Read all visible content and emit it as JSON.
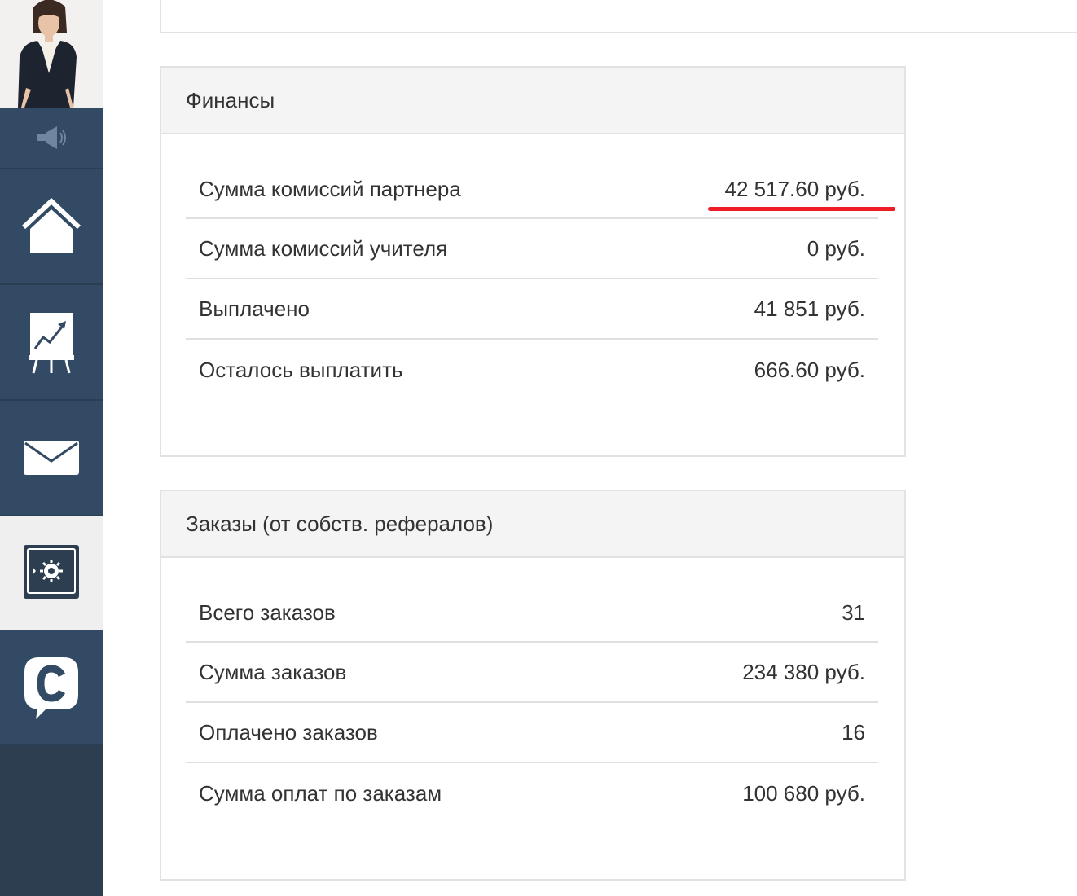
{
  "sidebar": {
    "avatar_alt": "",
    "items": [
      {
        "icon": "speaker-icon"
      },
      {
        "icon": "home-icon"
      },
      {
        "icon": "chart-icon"
      },
      {
        "icon": "mail-icon"
      },
      {
        "icon": "safe-icon",
        "active": true
      },
      {
        "icon": "chat-icon"
      }
    ]
  },
  "finance": {
    "title": "Финансы",
    "rows": [
      {
        "label": "Сумма комиссий партнера",
        "value": "42 517.60 руб."
      },
      {
        "label": "Сумма комиссий учителя",
        "value": "0 руб."
      },
      {
        "label": "Выплачено",
        "value": "41 851 руб."
      },
      {
        "label": "Осталось выплатить",
        "value": "666.60 руб."
      }
    ]
  },
  "orders": {
    "title": "Заказы (от собств. рефералов)",
    "rows": [
      {
        "label": "Всего заказов",
        "value": "31"
      },
      {
        "label": "Сумма заказов",
        "value": "234 380 руб."
      },
      {
        "label": "Оплачено заказов",
        "value": "16"
      },
      {
        "label": "Сумма оплат по заказам",
        "value": "100 680 руб."
      }
    ]
  },
  "colors": {
    "sidebar_bg": "#2c3e50",
    "nav_bg": "#324a63",
    "highlight": "#ee1c25"
  }
}
